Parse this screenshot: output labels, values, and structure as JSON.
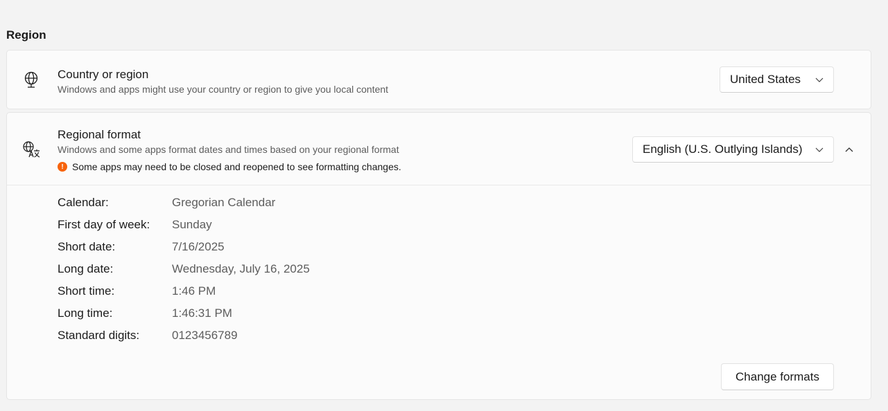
{
  "section": {
    "title": "Region"
  },
  "country": {
    "icon": "globe-icon",
    "title": "Country or region",
    "subtitle": "Windows and apps might use your country or region to give you local content",
    "selected": "United States"
  },
  "regional_format": {
    "icon": "language-icon",
    "title": "Regional format",
    "subtitle": "Windows and some apps format dates and times based on your regional format",
    "warning_icon": "warning-icon",
    "warning_color": "#f7630c",
    "warning": "Some apps may need to be closed and reopened to see formatting changes.",
    "selected": "English (U.S. Outlying Islands)",
    "expanded": true,
    "details": [
      {
        "label": "Calendar:",
        "value": "Gregorian Calendar"
      },
      {
        "label": "First day of week:",
        "value": "Sunday"
      },
      {
        "label": "Short date:",
        "value": "7/16/2025"
      },
      {
        "label": "Long date:",
        "value": "Wednesday, July 16, 2025"
      },
      {
        "label": "Short time:",
        "value": "1:46 PM"
      },
      {
        "label": "Long time:",
        "value": "1:46:31 PM"
      },
      {
        "label": "Standard digits:",
        "value": "0123456789"
      }
    ],
    "change_button": "Change formats"
  }
}
